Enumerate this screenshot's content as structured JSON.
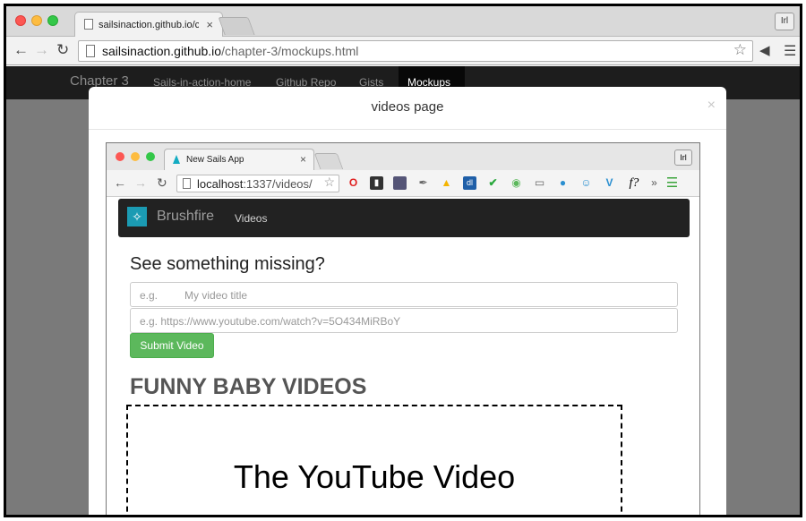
{
  "outer_browser": {
    "tab_title": "sailsinaction.github.io/chap",
    "tab_close": "×",
    "profile": "Irl",
    "url_host": "sailsinaction.github.io",
    "url_path": "/chapter-3/mockups.html"
  },
  "site_nav": {
    "brand": "Chapter 3",
    "links": [
      "Sails-in-action-home",
      "Github Repo",
      "Gists"
    ],
    "active": "Mockups"
  },
  "modal": {
    "title": "videos page",
    "close": "×"
  },
  "inner_browser": {
    "tab_title": "New Sails App",
    "tab_close": "×",
    "profile": "Irl",
    "url_host": "localhost",
    "url_path": ":1337/videos/",
    "more": "»"
  },
  "app": {
    "brand": "Brushfire",
    "nav_link": "Videos",
    "form_heading": "See something missing?",
    "title_placeholder": "e.g.         My video title",
    "url_placeholder": "e.g. https://www.youtube.com/watch?v=5O434MiRBoY",
    "submit_label": "Submit Video",
    "section_title": "FUNNY BABY VIDEOS",
    "video_placeholder": "The YouTube Video"
  },
  "colors": {
    "submit": "#5cb85c",
    "navbar": "#222222",
    "logo": "#1b9bb3"
  }
}
